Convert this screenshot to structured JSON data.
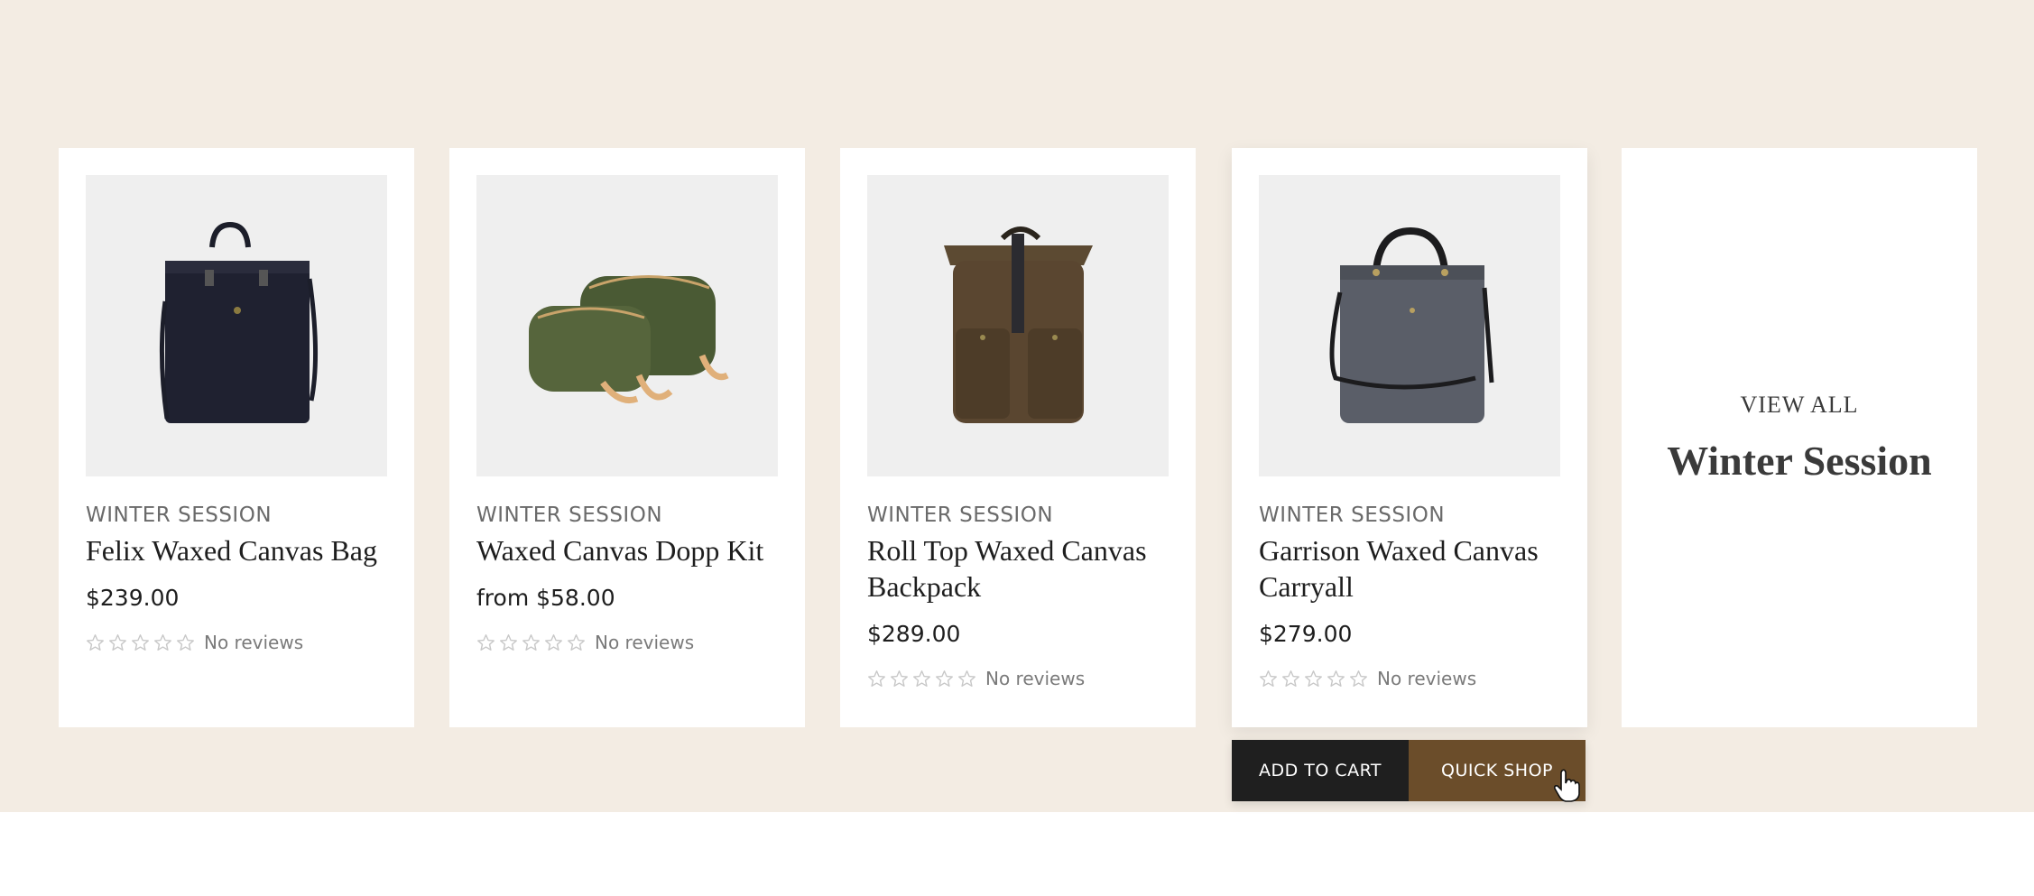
{
  "products": [
    {
      "collection": "WINTER SESSION",
      "title": "Felix Waxed Canvas Bag",
      "price": "$239.00",
      "reviews": "No reviews",
      "rating": 0,
      "rating_max": 5,
      "image_icon": "tote-bag-icon"
    },
    {
      "collection": "WINTER SESSION",
      "title": "Waxed Canvas Dopp Kit",
      "price": "from $58.00",
      "reviews": "No reviews",
      "rating": 0,
      "rating_max": 5,
      "image_icon": "dopp-kit-icon"
    },
    {
      "collection": "WINTER SESSION",
      "title": "Roll Top Waxed Canvas Backpack",
      "price": "$289.00",
      "reviews": "No reviews",
      "rating": 0,
      "rating_max": 5,
      "image_icon": "backpack-icon"
    },
    {
      "collection": "WINTER SESSION",
      "title": "Garrison Waxed Canvas Carryall",
      "price": "$279.00",
      "reviews": "No reviews",
      "rating": 0,
      "rating_max": 5,
      "image_icon": "carryall-icon"
    }
  ],
  "actions": {
    "add_to_cart": "ADD TO CART",
    "quick_shop": "QUICK SHOP"
  },
  "view_all": {
    "label": "VIEW ALL",
    "title": "Winter Session"
  },
  "colors": {
    "background": "#f3ece3",
    "card": "#ffffff",
    "image_bg": "#efefef",
    "add_to_cart": "#1f1f1f",
    "quick_shop": "#6b4d2a",
    "star": "#c8c8c8"
  }
}
